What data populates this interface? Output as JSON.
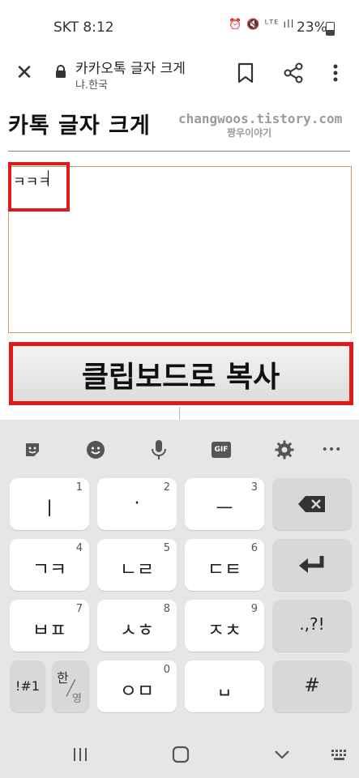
{
  "status": {
    "carrier_time": "SKT 8:12",
    "icons": "⏰ 🔇 ᴸᵀᴱ ıll",
    "battery": "23%"
  },
  "browser": {
    "title": "카카오톡 글자 크게",
    "host": "냐.한국"
  },
  "page": {
    "title": "카톡 글자 크게",
    "blog_url": "changwoos.tistory.com",
    "blog_name": "짱우이야기",
    "textarea_value": "ㅋㅋㅋ",
    "copy_button": "클립보드로 복사"
  },
  "keyboard": {
    "toolbar": [
      "sticker-icon",
      "emoji-icon",
      "mic-icon",
      "gif-icon",
      "settings-icon",
      "more-icon"
    ],
    "gif_label": "GIF",
    "more_label": "•••",
    "rows": [
      [
        {
          "label": "ㅣ",
          "num": "1"
        },
        {
          "label": "·",
          "num": "2"
        },
        {
          "label": "ㅡ",
          "num": "3"
        },
        {
          "label": "⌫",
          "num": ""
        }
      ],
      [
        {
          "label": "ㄱㅋ",
          "num": "4"
        },
        {
          "label": "ㄴㄹ",
          "num": "5"
        },
        {
          "label": "ㄷㅌ",
          "num": "6"
        },
        {
          "label": "↵",
          "num": ""
        }
      ],
      [
        {
          "label": "ㅂㅍ",
          "num": "7"
        },
        {
          "label": "ㅅㅎ",
          "num": "8"
        },
        {
          "label": "ㅈㅊ",
          "num": "9"
        },
        {
          "label": ".,?!",
          "num": ""
        }
      ]
    ],
    "bottom": {
      "symbols": "!#1",
      "lang_top": "한",
      "lang_bottom": "영",
      "om": "ㅇㅁ",
      "om_num": "0",
      "space": "␣",
      "hash": "#"
    }
  }
}
